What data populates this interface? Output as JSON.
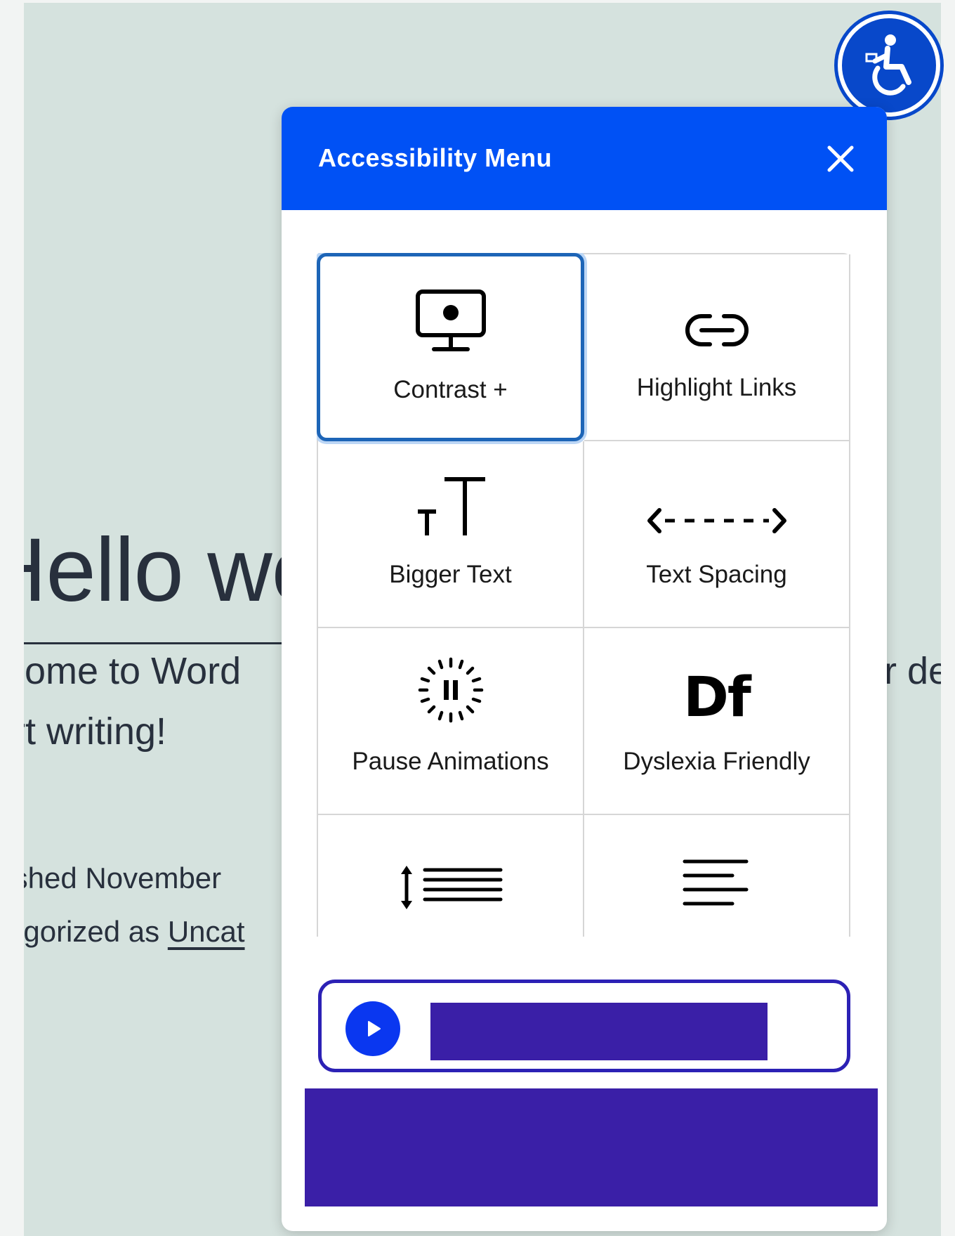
{
  "background_page": {
    "title_fragment": "Hello wo",
    "body_line_1": "lcome to Word",
    "body_line_1_right": "r de",
    "body_line_2": "rt writing!",
    "meta_line_1": "lished November",
    "meta_line_2_prefix": "egorized as ",
    "meta_line_2_link": "Uncat"
  },
  "toggle": {
    "icon": "accessibility-person-icon"
  },
  "menu": {
    "title": "Accessibility Menu",
    "close_icon": "close-icon",
    "tiles": [
      {
        "label": "Contrast +",
        "icon": "monitor-contrast-icon",
        "selected": true
      },
      {
        "label": "Highlight Links",
        "icon": "link-icon",
        "selected": false
      },
      {
        "label": "Bigger Text",
        "icon": "text-size-icon",
        "selected": false
      },
      {
        "label": "Text Spacing",
        "icon": "text-spacing-icon",
        "selected": false
      },
      {
        "label": "Pause Animations",
        "icon": "pause-animations-icon",
        "selected": false
      },
      {
        "label": "Dyslexia Friendly",
        "icon": "dyslexia-font-icon",
        "selected": false,
        "glyph": "Df"
      },
      {
        "label": "",
        "icon": "line-height-icon",
        "selected": false
      },
      {
        "label": "",
        "icon": "text-align-icon",
        "selected": false
      }
    ],
    "player": {
      "play_icon": "play-icon"
    }
  },
  "colors": {
    "header_blue": "#0051f5",
    "accent_purple": "#3a1fa7",
    "selected_border": "#1d65b7",
    "page_bg": "#d5e2de"
  }
}
